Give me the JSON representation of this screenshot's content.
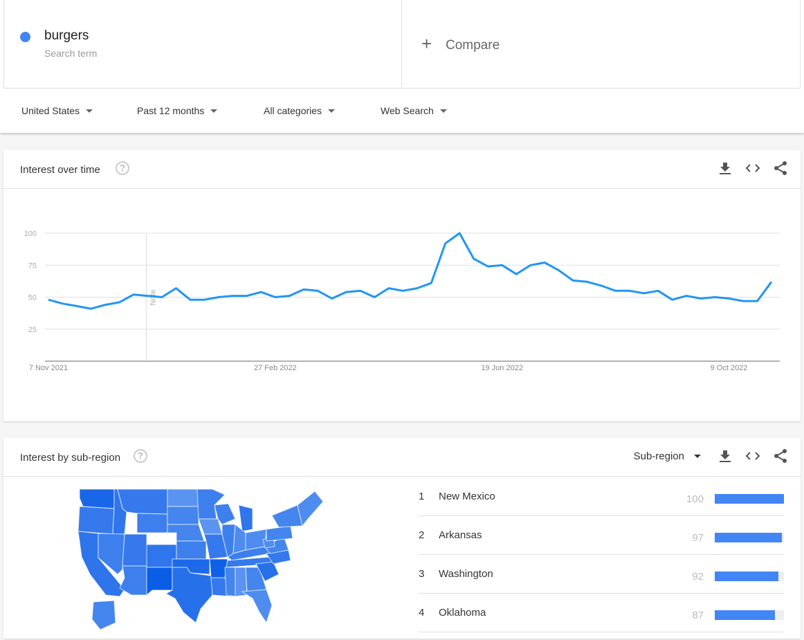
{
  "search": {
    "term": "burgers",
    "term_type": "Search term",
    "term_color": "#4285f4",
    "compare_label": "Compare",
    "compare_icon": "plus-icon"
  },
  "filters": {
    "region": "United States",
    "period": "Past 12 months",
    "category": "All categories",
    "property": "Web Search"
  },
  "interest_over_time": {
    "title": "Interest over time",
    "actions": [
      "download-icon",
      "embed-icon",
      "share-icon"
    ],
    "note_label": "Note"
  },
  "interest_by_subregion": {
    "title": "Interest by sub-region",
    "resolution": "Sub-region",
    "actions": [
      "download-icon",
      "embed-icon",
      "share-icon"
    ],
    "rows": [
      {
        "rank": "1",
        "region": "New Mexico",
        "value": 100
      },
      {
        "rank": "2",
        "region": "Arkansas",
        "value": 97
      },
      {
        "rank": "3",
        "region": "Washington",
        "value": 92
      },
      {
        "rank": "4",
        "region": "Oklahoma",
        "value": 87
      }
    ]
  },
  "chart_data": {
    "type": "line",
    "title": "Interest over time",
    "xlabel": "",
    "ylabel": "",
    "ylim": [
      0,
      100
    ],
    "yticks": [
      25,
      50,
      75,
      100
    ],
    "xtick_labels": [
      "7 Nov 2021",
      "27 Feb 2022",
      "19 Jun 2022",
      "9 Oct 2022"
    ],
    "xtick_indices": [
      0,
      16,
      32,
      48
    ],
    "note_index": 7,
    "grid": true,
    "series": [
      {
        "name": "burgers",
        "color": "#2196f3",
        "values": [
          48,
          45,
          43,
          41,
          44,
          46,
          52,
          51,
          50,
          57,
          48,
          48,
          50,
          51,
          51,
          54,
          50,
          51,
          56,
          55,
          49,
          54,
          55,
          50,
          57,
          55,
          57,
          61,
          92,
          100,
          80,
          74,
          75,
          68,
          75,
          77,
          71,
          63,
          62,
          59,
          55,
          55,
          53,
          55,
          48,
          51,
          49,
          50,
          49,
          47,
          47,
          62
        ]
      }
    ]
  }
}
